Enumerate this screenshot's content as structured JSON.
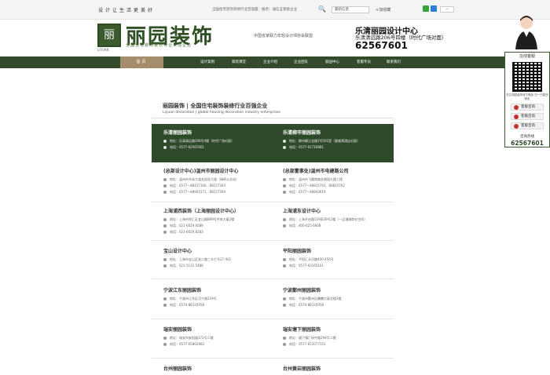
{
  "topbar": {
    "slogan": "设计让生活更美好",
    "notice": "全国住宅装饰装修行业百强量：服务：诚信五星级企业",
    "search_icon": "search-icon",
    "select_value": "最新信息",
    "favorite": "+加收藏",
    "lang": "—"
  },
  "header": {
    "logo_mark": "丽",
    "logo_text": "丽园装饰",
    "logo_sub": "全国住宅装饰装修行业百强企业",
    "logo_en": "LIYUAN",
    "alliance": "中国省家联力年轻设计师协会联盟",
    "headline1": "乐清丽园设计中心",
    "headline2": "乐清清远路206号四楼（时代广场对面）",
    "phone": "62567601"
  },
  "nav": {
    "home": "首页",
    "items": [
      "设计案例",
      "家装课堂",
      "企业介绍",
      "企业团队",
      "丽园中心",
      "客服专员",
      "联系我们"
    ]
  },
  "content": {
    "title": "丽园装饰 | 全国住宅装饰装修行业百强企业",
    "subtitle": "Liyuan decoration | global housing decoration industry enterprises"
  },
  "branches": [
    {
      "name": "乐清丽园装饰",
      "address": "地址：乐清清远路206号4楼（时代广场对面）",
      "phone": "电话：0577-62567601"
    },
    {
      "name": "乐清柳市丽园装饰",
      "address": "地址：柳市柳江北路1号502室（夏威夷酒店对面）",
      "phone": "电话：0577-61716881"
    },
    {
      "name": "(总部设计中心)温州市丽园设计中心",
      "address": "地址：温州市车站大道金园花大楼（瑞晖公交站）",
      "phone": "电话：0577—88157300、88157303",
      "phone2": "电话：0577—88901571、88157309"
    },
    {
      "name": "(总部董事处)温州市电建路公司",
      "address": "地址：温州市飞霞南路金雅园九楼三楼",
      "phone": "电话：0577—88815701、88815702",
      "phone2": "电话：0577—88843619"
    },
    {
      "name": "上海浦西装饰（上海丽园设计中心）",
      "address": "地址：上海市徐汇区宜山路889号齐来大厦2楼",
      "phone": "电话：021-6029 8289",
      "phone2": "电话：021-6029 8283"
    },
    {
      "name": "上海浦东设计中心",
      "address": "地址：上海开启路129弄39号2楼（—品漫城商业空间）",
      "phone": "电话：400-625-6608"
    },
    {
      "name": "宝山设计中心",
      "address": "地址：上海市宝山区淞二路三丰七号27-401",
      "phone": "电话：021-5131 5486"
    },
    {
      "name": "平阳丽园装饰",
      "address": "地址：平阳汇水河路400-456号",
      "phone": "电话：0577-63165101"
    },
    {
      "name": "宁波江东丽园装饰",
      "address": "地址：宁波市江东区河宁路229号",
      "phone": "电话：0574-88120958"
    },
    {
      "name": "宁波鄞州丽园装饰",
      "address": "地址：宁波市鄞州区麟麟大厦北楼3楼",
      "phone": "电话：0574-88120958"
    },
    {
      "name": "瑞安丽园装饰",
      "address": "地址：瑞安市安阳路372号二楼",
      "phone": "电话：0577-65862802"
    },
    {
      "name": "瑞安塘下丽园装饰",
      "address": "地址：塘下镇广场中路299号二楼",
      "phone": "电话：0577-653577151"
    },
    {
      "name": "台州丽园装饰"
    },
    {
      "name": "台州黄岩丽园装饰"
    }
  ],
  "sidebar": {
    "title": "在线客服",
    "qr_note": "关注丽园装饰官方微信 扫一扫更多精彩",
    "btn1": "客服咨询",
    "btn2": "客服咨询",
    "btn3": "客服咨询",
    "hot_label": "咨询热线",
    "hot_number": "62567601"
  },
  "colors": {
    "nav_bg": "#334a2b",
    "home_tab": "#a38d6a",
    "green_box": "#2f4a2b"
  }
}
